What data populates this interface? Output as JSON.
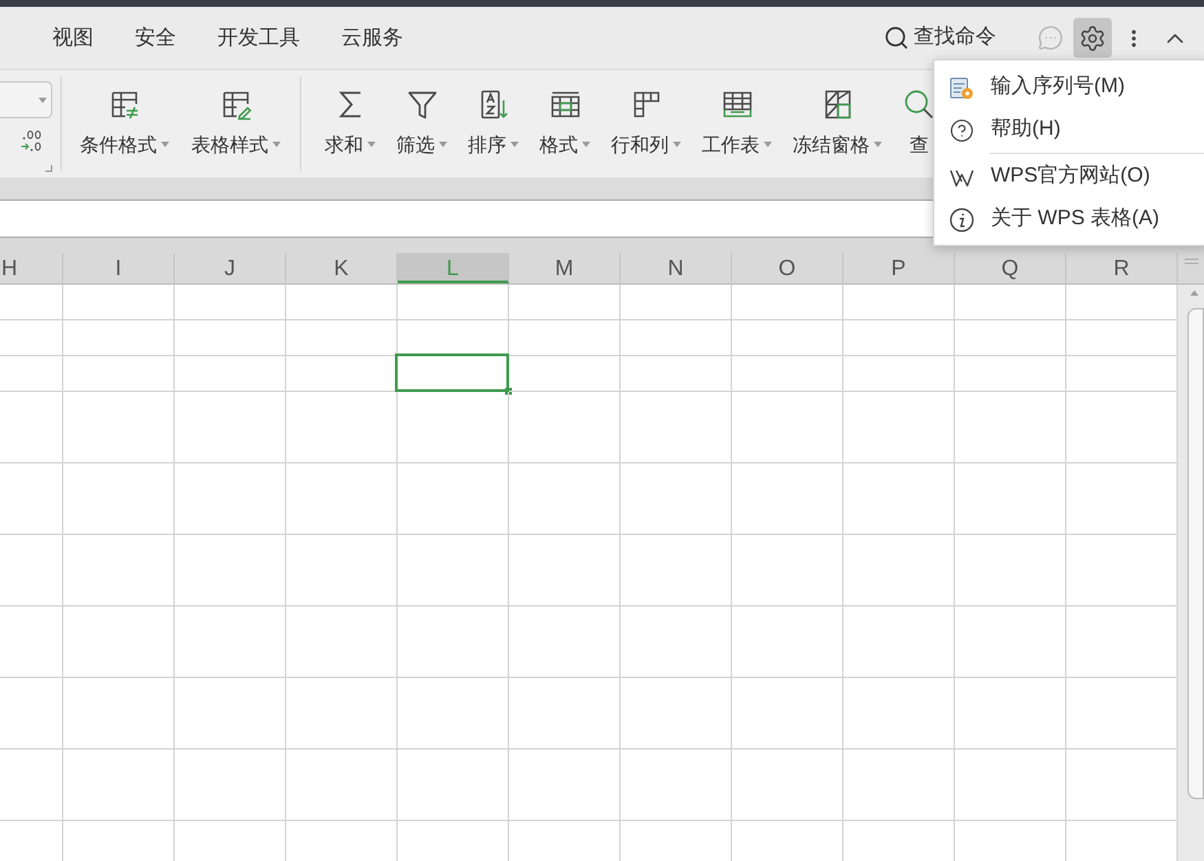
{
  "menu_tabs": [
    {
      "label": "视图",
      "selected": false
    },
    {
      "label": "安全",
      "selected": false
    },
    {
      "label": "开发工具",
      "selected": false
    },
    {
      "label": "云服务",
      "selected": false
    }
  ],
  "command_search": {
    "label": "查找命令"
  },
  "settings_menu": {
    "open": true,
    "items": [
      {
        "kind": "command",
        "label": "输入序列号(M)"
      },
      {
        "kind": "command",
        "label": "帮助(H)"
      },
      {
        "kind": "separator"
      },
      {
        "kind": "command",
        "label": "WPS官方网站(O)"
      },
      {
        "kind": "command",
        "label": "关于 WPS 表格(A)"
      }
    ]
  },
  "ribbon": {
    "groups": [
      {
        "buttons": [
          {
            "label": "条件格式",
            "dropdown": true
          },
          {
            "label": "表格样式",
            "dropdown": true
          }
        ]
      },
      {
        "buttons": [
          {
            "label": "求和",
            "dropdown": true
          },
          {
            "label": "筛选",
            "dropdown": true
          },
          {
            "label": "排序",
            "dropdown": true
          },
          {
            "label": "格式",
            "dropdown": true
          },
          {
            "label": "行和列",
            "dropdown": true
          },
          {
            "label": "工作表",
            "dropdown": true
          },
          {
            "label": "冻结窗格",
            "dropdown": true
          },
          {
            "label": "查",
            "dropdown": false
          }
        ]
      }
    ]
  },
  "sheet": {
    "columns": [
      {
        "label": "H",
        "selected": false
      },
      {
        "label": "I",
        "selected": false
      },
      {
        "label": "J",
        "selected": false
      },
      {
        "label": "K",
        "selected": false
      },
      {
        "label": "L",
        "selected": true
      },
      {
        "label": "M",
        "selected": false
      },
      {
        "label": "N",
        "selected": false
      },
      {
        "label": "O",
        "selected": false
      },
      {
        "label": "P",
        "selected": false
      },
      {
        "label": "Q",
        "selected": false
      },
      {
        "label": "R",
        "selected": false
      }
    ],
    "rows": [
      {
        "selected": false
      },
      {
        "selected": false
      },
      {
        "selected": true
      },
      {
        "selected": false
      },
      {
        "selected": false
      },
      {
        "selected": false
      },
      {
        "selected": false
      },
      {
        "selected": false
      },
      {
        "selected": false
      },
      {
        "selected": false
      }
    ]
  }
}
